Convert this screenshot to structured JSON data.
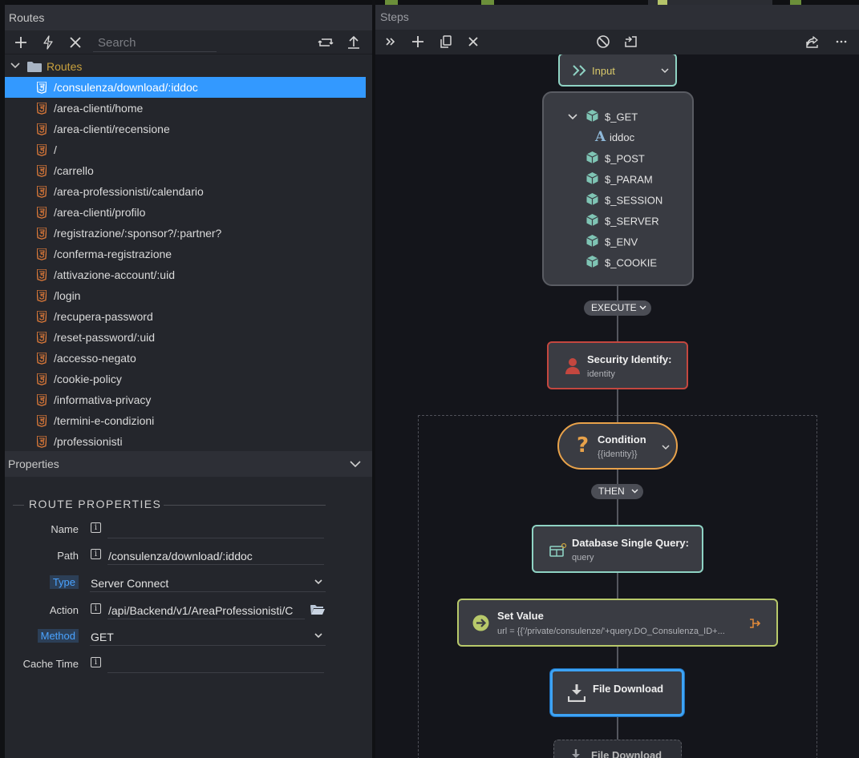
{
  "routes_panel": {
    "title": "Routes",
    "search_placeholder": "Search",
    "root_label": "Routes",
    "routes": [
      "/consulenza/download/:iddoc",
      "/area-clienti/home",
      "/area-clienti/recensione",
      "/",
      "/carrello",
      "/area-professionisti/calendario",
      "/area-clienti/profilo",
      "/registrazione/:sponsor?/:partner?",
      "/conferma-registrazione",
      "/attivazione-account/:uid",
      "/login",
      "/recupera-password",
      "/reset-password/:uid",
      "/accesso-negato",
      "/cookie-policy",
      "/informativa-privacy",
      "/termini-e-condizioni",
      "/professionisti"
    ],
    "selected_index": 0
  },
  "properties": {
    "title": "Properties",
    "section_title": "ROUTE PROPERTIES",
    "name_label": "Name",
    "name_value": "",
    "path_label": "Path",
    "path_value": "/consulenza/download/:iddoc",
    "type_label": "Type",
    "type_value": "Server Connect",
    "action_label": "Action",
    "action_value": "/api/Backend/v1/AreaProfessionisti/C",
    "method_label": "Method",
    "method_value": "GET",
    "cache_label": "Cache Time",
    "cache_value": ""
  },
  "steps": {
    "title": "Steps",
    "input_node": {
      "label": "Input"
    },
    "input_items": [
      "$_GET",
      "iddoc",
      "$_POST",
      "$_PARAM",
      "$_SESSION",
      "$_SERVER",
      "$_ENV",
      "$_COOKIE"
    ],
    "execute_label": "EXECUTE",
    "security": {
      "title": "Security Identify:",
      "sub": "identity"
    },
    "condition": {
      "title": "Condition",
      "sub": "{{identity}}"
    },
    "then_label": "THEN",
    "dbquery": {
      "title": "Database Single Query:",
      "sub": "query"
    },
    "setvalue": {
      "title": "Set Value",
      "sub": "url = {{'/private/consulenze/'+query.DO_Consulenza_ID+..."
    },
    "filedownload": {
      "title": "File Download"
    },
    "filedownload2": {
      "title": "File Download"
    }
  },
  "colors": {
    "selection": "#3399ff",
    "teal_border": "#8fd3c4",
    "security_border": "#c4473f",
    "condition_border": "#e8a24a",
    "setvalue_border": "#b8c96a",
    "filedownload_border": "#3da3f5",
    "route_icon": "#e07b39"
  }
}
